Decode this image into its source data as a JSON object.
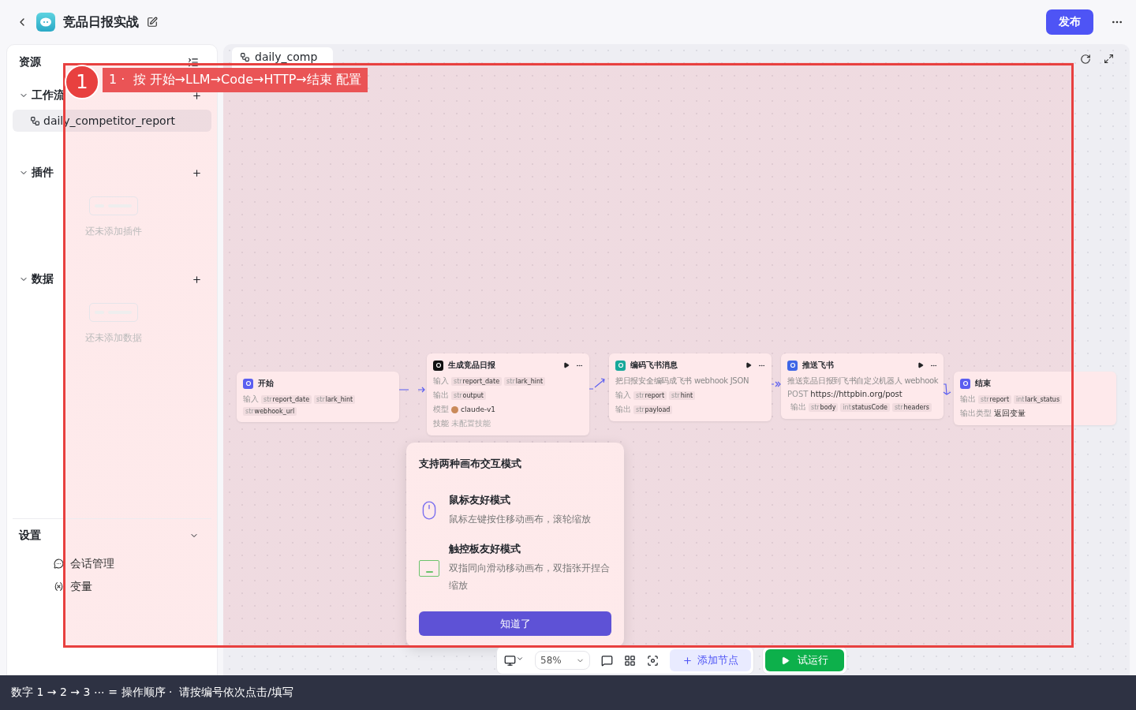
{
  "header": {
    "title": "竞品日报实战",
    "publish": "发布"
  },
  "sidebar": {
    "title": "资源",
    "sections": [
      {
        "label": "工作流",
        "expanded": true,
        "items": [
          {
            "label": "daily_competitor_report",
            "selected": true
          }
        ]
      },
      {
        "label": "插件",
        "expanded": true,
        "empty": "还未添加插件"
      },
      {
        "label": "数据",
        "expanded": true,
        "empty": "还未添加数据"
      }
    ],
    "settings": {
      "label": "设置",
      "expanded": true,
      "items": [
        {
          "kind": "session",
          "label": "会话管理"
        },
        {
          "kind": "variable",
          "label": "变量"
        }
      ]
    }
  },
  "canvas": {
    "tab": "daily_comp",
    "nodes": [
      {
        "kind": "start",
        "title": "开始",
        "rows": [
          {
            "label": "输入",
            "tags": [
              {
                "type": "str",
                "name": "report_date"
              },
              {
                "type": "str",
                "name": "lark_hint"
              },
              {
                "type": "str",
                "name": "webhook_url"
              }
            ]
          }
        ]
      },
      {
        "kind": "llm",
        "title": "生成竞品日报",
        "rows": [
          {
            "label": "输入",
            "tags": [
              {
                "type": "str",
                "name": "report_date"
              },
              {
                "type": "str",
                "name": "lark_hint"
              }
            ]
          },
          {
            "label": "输出",
            "tags": [
              {
                "type": "str",
                "name": "output"
              }
            ]
          },
          {
            "label": "模型",
            "model": "claude-v1"
          },
          {
            "label": "技能",
            "muted": "未配置技能"
          }
        ]
      },
      {
        "kind": "code",
        "title": "编码飞书消息",
        "description": "把日报安全编码成飞书 webhook JSON",
        "rows": [
          {
            "label": "输入",
            "tags": [
              {
                "type": "str",
                "name": "report"
              },
              {
                "type": "str",
                "name": "hint"
              }
            ]
          },
          {
            "label": "输出",
            "tags": [
              {
                "type": "str",
                "name": "payload"
              }
            ]
          }
        ]
      },
      {
        "kind": "http",
        "title": "推送飞书",
        "description": "推送竞品日报到飞书自定义机器人 webhook",
        "rows": [
          {
            "label": "POST",
            "value": "https://httpbin.org/post"
          },
          {
            "label": "输出",
            "tags": [
              {
                "type": "str",
                "name": "body"
              },
              {
                "type": "int",
                "name": "statusCode"
              },
              {
                "type": "str",
                "name": "headers"
              }
            ]
          }
        ]
      },
      {
        "kind": "end",
        "title": "结束",
        "rows": [
          {
            "label": "输出",
            "tags": [
              {
                "type": "str",
                "name": "report"
              },
              {
                "type": "int",
                "name": "lark_status"
              }
            ]
          },
          {
            "label": "输出类型",
            "value": "返回变量"
          }
        ]
      }
    ],
    "popover": {
      "title": "支持两种画布交互模式",
      "modes": [
        {
          "kind": "mouse",
          "title": "鼠标友好模式",
          "text": "鼠标左键按住移动画布，滚轮缩放"
        },
        {
          "kind": "trackpad",
          "title": "触控板友好模式",
          "text": "双指同向滑动移动画布，双指张开捏合缩放"
        }
      ],
      "button": "知道了"
    },
    "toolbar": {
      "zoom": "58%",
      "add": "添加节点",
      "run": "试运行"
    }
  },
  "annotation": {
    "number": "1",
    "text": "1 ·  按 开始→LLM→Code→HTTP→结束 配置"
  },
  "banner": "数字 1 → 2 → 3 ⋯ = 操作顺序 ·  请按编号依次点击/填写"
}
